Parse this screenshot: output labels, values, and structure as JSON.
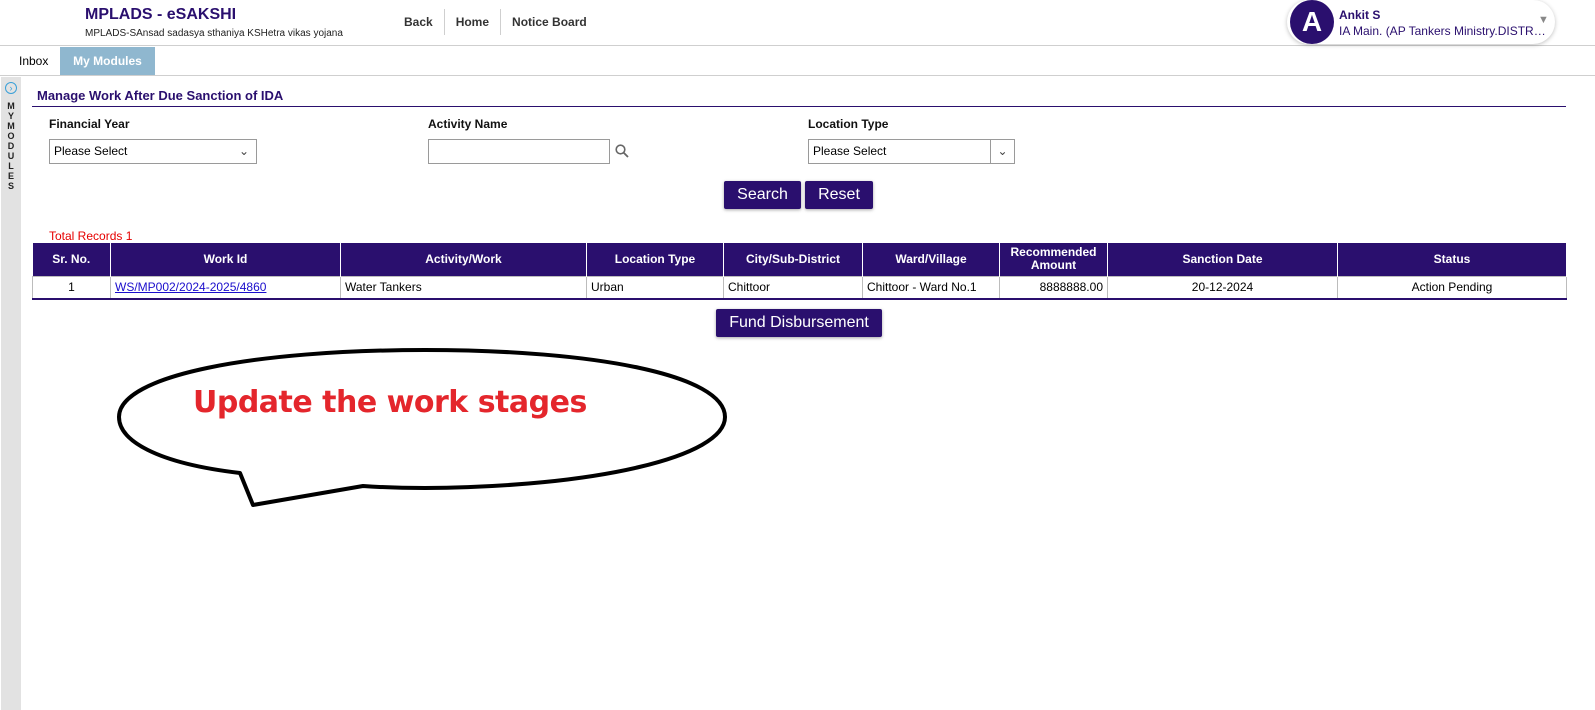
{
  "header": {
    "brand_title": "MPLADS - eSAKSHI",
    "brand_subtitle": "MPLADS-SAnsad sadasya sthaniya KSHetra vikas yojana",
    "nav": [
      "Back",
      "Home",
      "Notice Board"
    ],
    "user": {
      "initial": "A",
      "name": "Ankit S",
      "role": "IA Main. (AP Tankers Ministry.DISTRICT"
    }
  },
  "tabs": {
    "inbox": "Inbox",
    "my_modules": "My Modules"
  },
  "sidebar": {
    "label": "M Y M O D U L E S"
  },
  "page": {
    "title": "Manage Work After Due Sanction of IDA"
  },
  "filters": {
    "financial_year": {
      "label": "Financial Year",
      "value": "Please Select"
    },
    "activity_name": {
      "label": "Activity Name",
      "value": ""
    },
    "location_type": {
      "label": "Location Type",
      "value": "Please Select"
    }
  },
  "buttons": {
    "search": "Search",
    "reset": "Reset",
    "fund_disbursement": "Fund Disbursement"
  },
  "results": {
    "total_label": "Total Records",
    "total_count": "1",
    "columns": [
      "Sr. No.",
      "Work Id",
      "Activity/Work",
      "Location Type",
      "City/Sub-District",
      "Ward/Village",
      "Recommended Amount",
      "Sanction Date",
      "Status"
    ],
    "rows": [
      {
        "sr_no": "1",
        "work_id": "WS/MP002/2024-2025/4860",
        "activity": "Water Tankers",
        "location_type": "Urban",
        "city": "Chittoor",
        "ward": "Chittoor - Ward No.1",
        "amount": "8888888.00",
        "sanction_date": "20-12-2024",
        "status": "Action Pending"
      }
    ]
  },
  "callout": {
    "text": "Update the work stages",
    "color": "#e4262c"
  },
  "colors": {
    "primary": "#2a0f6e",
    "tab_active": "#8fb7cf",
    "alert": "#e60000"
  }
}
